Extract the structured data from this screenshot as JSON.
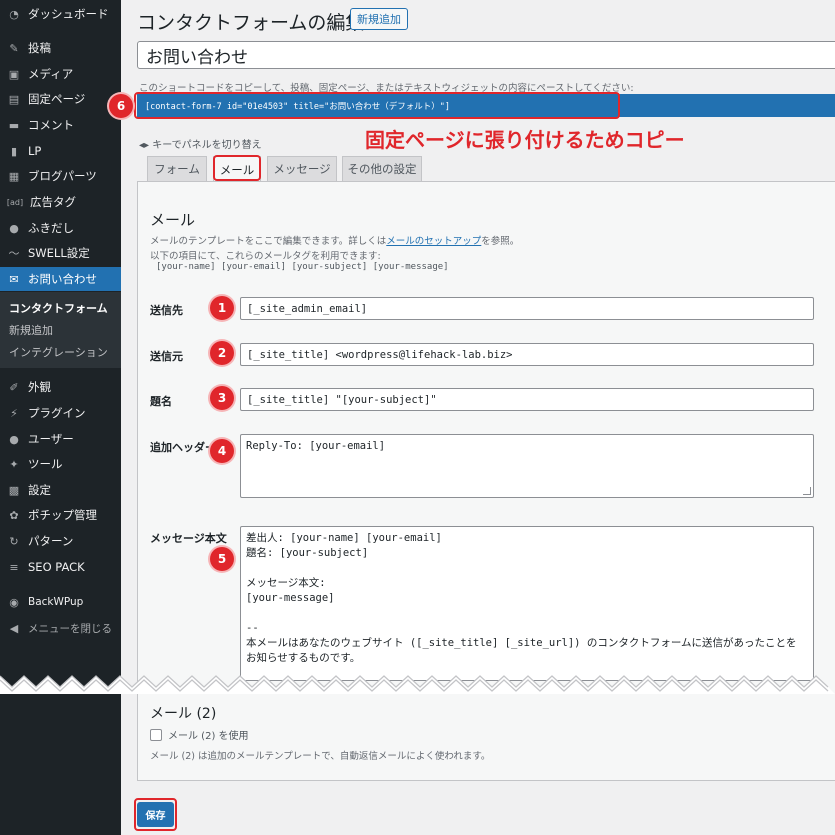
{
  "sidebar": {
    "items": [
      {
        "label": "ダッシュボード",
        "icon": "dashboard-icon",
        "glyph": "◔"
      },
      {
        "label": "投稿",
        "icon": "pin-icon",
        "glyph": "✎"
      },
      {
        "label": "メディア",
        "icon": "media-icon",
        "glyph": "▣"
      },
      {
        "label": "固定ページ",
        "icon": "page-icon",
        "glyph": "▤"
      },
      {
        "label": "コメント",
        "icon": "comment-icon",
        "glyph": "▬"
      },
      {
        "label": "LP",
        "icon": "document-icon",
        "glyph": "▮"
      },
      {
        "label": "ブログパーツ",
        "icon": "grid-icon",
        "glyph": "▦"
      },
      {
        "label": "広告タグ",
        "icon": "ad-icon",
        "glyph": "[ad]"
      },
      {
        "label": "ふきだし",
        "icon": "speech-bubble-icon",
        "glyph": "●"
      },
      {
        "label": "SWELL設定",
        "icon": "swell-icon",
        "glyph": "〜"
      },
      {
        "label": "お問い合わせ",
        "icon": "mail-icon",
        "glyph": "✉"
      },
      {
        "label": "外観",
        "icon": "brush-icon",
        "glyph": "✐"
      },
      {
        "label": "プラグイン",
        "icon": "plugin-icon",
        "glyph": "⚡"
      },
      {
        "label": "ユーザー",
        "icon": "user-icon",
        "glyph": "●"
      },
      {
        "label": "ツール",
        "icon": "wrench-icon",
        "glyph": "✦"
      },
      {
        "label": "設定",
        "icon": "settings-icon",
        "glyph": "▩"
      },
      {
        "label": "ポチップ管理",
        "icon": "paw-icon",
        "glyph": "✿"
      },
      {
        "label": "パターン",
        "icon": "pattern-icon",
        "glyph": "↻"
      },
      {
        "label": "SEO PACK",
        "icon": "seo-icon",
        "glyph": "≡"
      },
      {
        "label": "BackWPup",
        "icon": "backwpup-icon",
        "glyph": "◉"
      },
      {
        "label": "メニューを閉じる",
        "icon": "collapse-icon",
        "glyph": "◀"
      }
    ],
    "submenu": [
      "コンタクトフォーム",
      "新規追加",
      "インテグレーション"
    ]
  },
  "header": {
    "title": "コンタクトフォームの編集",
    "add_new": "新規追加"
  },
  "form_title": "お問い合わせ",
  "shortcode": {
    "description": "このショートコードをコピーして、投稿、固定ページ、またはテキストウィジェットの内容にペーストしてください:",
    "code": "[contact-form-7 id=\"01e4503\" title=\"お問い合わせ（デフォルト）\"]"
  },
  "annotation": {
    "text": "固定ページに張り付けるためコピー",
    "color": "#e0262b"
  },
  "keyswitch": "◂▸ キーでパネルを切り替え",
  "tabs": [
    "フォーム",
    "メール",
    "メッセージ",
    "その他の設定"
  ],
  "mail": {
    "section_title": "メール",
    "desc1_before": "メールのテンプレートをここで編集できます。詳しくは",
    "desc1_link": "メールのセットアップ",
    "desc1_after": "を参照。",
    "desc2": "以下の項目にて、これらのメールタグを利用できます:",
    "tags": "[your-name] [your-email] [your-subject] [your-message]",
    "fields": {
      "to_label": "送信先",
      "to_value": "[_site_admin_email]",
      "from_label": "送信元",
      "from_value": "[_site_title] <wordpress@lifehack-lab.biz>",
      "subject_label": "題名",
      "subject_value": "[_site_title] \"[your-subject]\"",
      "headers_label": "追加ヘッダー",
      "headers_value": "Reply-To: [your-email]",
      "body_label": "メッセージ本文",
      "body_value": "差出人: [your-name] [your-email]\n題名: [your-subject]\n\nメッセージ本文:\n[your-message]\n\n-- \n本メールはあなたのウェブサイト ([_site_title] [_site_url]) のコンタクトフォームに送信があったことを\nお知らせするものです。"
    }
  },
  "mail2": {
    "title": "メール (2)",
    "checkbox_label": "メール (2) を使用",
    "description": "メール (2) は追加のメールテンプレートで、自動返信メールによく使われます。"
  },
  "save_label": "保存",
  "badges": [
    "1",
    "2",
    "3",
    "4",
    "5",
    "6"
  ],
  "colors": {
    "accent": "#2271b1",
    "sidebar": "#1d2327",
    "annotation_red": "#e0262b"
  }
}
